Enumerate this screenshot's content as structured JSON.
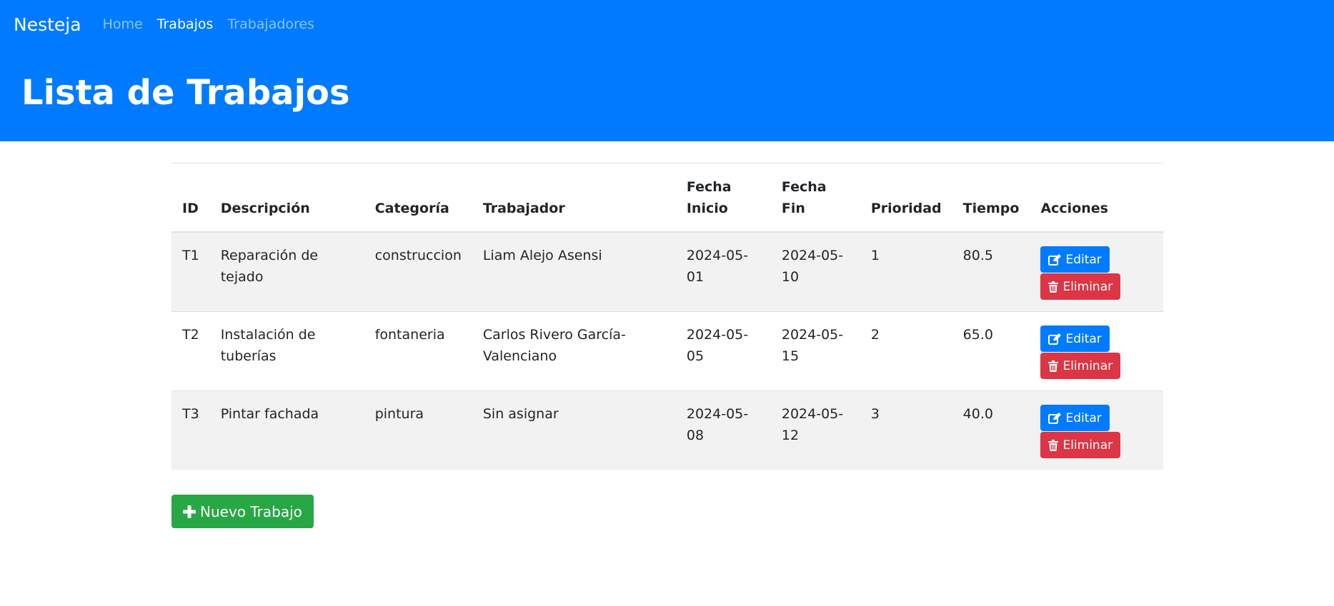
{
  "navbar": {
    "brand": "Nesteja",
    "links": [
      "Home",
      "Trabajos",
      "Trabajadores"
    ]
  },
  "page": {
    "title": "Lista de Trabajos"
  },
  "table": {
    "headers": {
      "id": "ID",
      "descripcion": "Descripción",
      "categoria": "Categoría",
      "trabajador": "Trabajador",
      "fecha_inicio": "Fecha Inicio",
      "fecha_fin": "Fecha Fin",
      "prioridad": "Prioridad",
      "tiempo": "Tiempo",
      "acciones": "Acciones"
    },
    "rows": [
      {
        "id": "T1",
        "descripcion": "Reparación de tejado",
        "categoria": "construccion",
        "trabajador": "Liam Alejo Asensi",
        "fecha_inicio": "2024-05-01",
        "fecha_fin": "2024-05-10",
        "prioridad": "1",
        "tiempo": "80.5"
      },
      {
        "id": "T2",
        "descripcion": "Instalación de tuberías",
        "categoria": "fontaneria",
        "trabajador": "Carlos Rivero García-Valenciano",
        "fecha_inicio": "2024-05-05",
        "fecha_fin": "2024-05-15",
        "prioridad": "2",
        "tiempo": "65.0"
      },
      {
        "id": "T3",
        "descripcion": "Pintar fachada",
        "categoria": "pintura",
        "trabajador": "Sin asignar",
        "fecha_inicio": "2024-05-08",
        "fecha_fin": "2024-05-12",
        "prioridad": "3",
        "tiempo": "40.0"
      }
    ]
  },
  "actions": {
    "edit_label": "Editar",
    "delete_label": "Eliminar",
    "new_label": "Nuevo Trabajo"
  },
  "colors": {
    "primary": "#007bff",
    "danger": "#dc3545",
    "success": "#28a745",
    "stripe": "#f2f2f2"
  }
}
